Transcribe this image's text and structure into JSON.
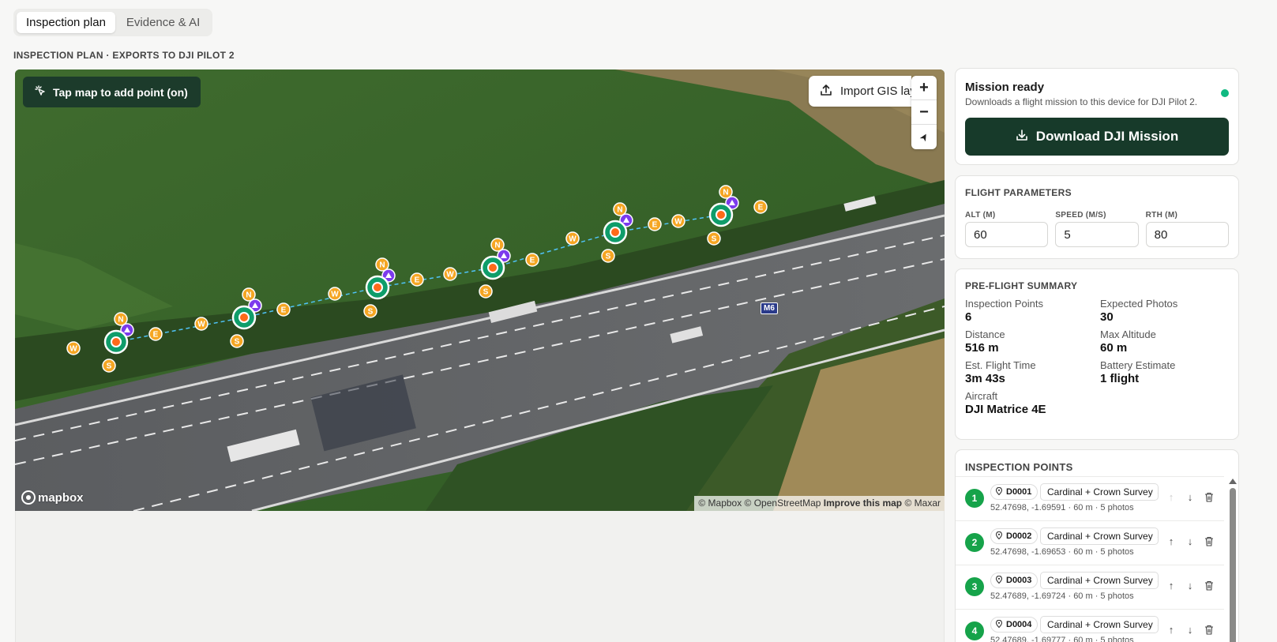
{
  "tabs": [
    {
      "label": "Inspection plan",
      "active": true
    },
    {
      "label": "Evidence & AI",
      "active": false
    }
  ],
  "section_label": "INSPECTION PLAN · EXPORTS TO DJI PILOT 2",
  "map": {
    "tap_button": "Tap map to add point (on)",
    "import_button": "Import GIS layer",
    "zoom_in": "+",
    "zoom_out": "−",
    "compass": "➤",
    "road_shield": "M6",
    "logo": "mapbox",
    "attribution_1": "© Mapbox © OpenStreetMap",
    "attribution_2": "Improve this map",
    "attribution_3": "© Maxar",
    "cardinal_labels": {
      "n": "N",
      "e": "E",
      "s": "S",
      "w": "W"
    },
    "colors": {
      "waypoint": "#0f9d6a",
      "cardinal": "#f5a623",
      "crown": "#7c3aed",
      "path": "#4fc3f7"
    }
  },
  "mission": {
    "title": "Mission ready",
    "subtitle": "Downloads a flight mission to this device for DJI Pilot 2.",
    "download_label": "Download DJI Mission",
    "status_color": "#10b981"
  },
  "flight_params": {
    "heading": "FLIGHT PARAMETERS",
    "alt_label": "ALT (M)",
    "alt_value": "60",
    "speed_label": "SPEED (M/S)",
    "speed_value": "5",
    "rth_label": "RTH (M)",
    "rth_value": "80"
  },
  "summary": {
    "heading": "PRE-FLIGHT SUMMARY",
    "items": [
      {
        "k": "Inspection Points",
        "v": "6"
      },
      {
        "k": "Expected Photos",
        "v": "30"
      },
      {
        "k": "Distance",
        "v": "516 m"
      },
      {
        "k": "Max Altitude",
        "v": "60 m"
      },
      {
        "k": "Est. Flight Time",
        "v": "3m 43s"
      },
      {
        "k": "Battery Estimate",
        "v": "1 flight"
      },
      {
        "k": "Aircraft",
        "v": "DJI Matrice 4E"
      }
    ]
  },
  "points": {
    "heading": "INSPECTION POINTS",
    "items": [
      {
        "num": "1",
        "id": "D0001",
        "mode": "Cardinal + Crown Survey",
        "meta": "52.47698, -1.69591 · 60 m · 5 photos"
      },
      {
        "num": "2",
        "id": "D0002",
        "mode": "Cardinal + Crown Survey",
        "meta": "52.47698, -1.69653 · 60 m · 5 photos"
      },
      {
        "num": "3",
        "id": "D0003",
        "mode": "Cardinal + Crown Survey",
        "meta": "52.47689, -1.69724 · 60 m · 5 photos"
      },
      {
        "num": "4",
        "id": "D0004",
        "mode": "Cardinal + Crown Survey",
        "meta": "52.47689, -1.69777 · 60 m · 5 photos"
      }
    ]
  }
}
